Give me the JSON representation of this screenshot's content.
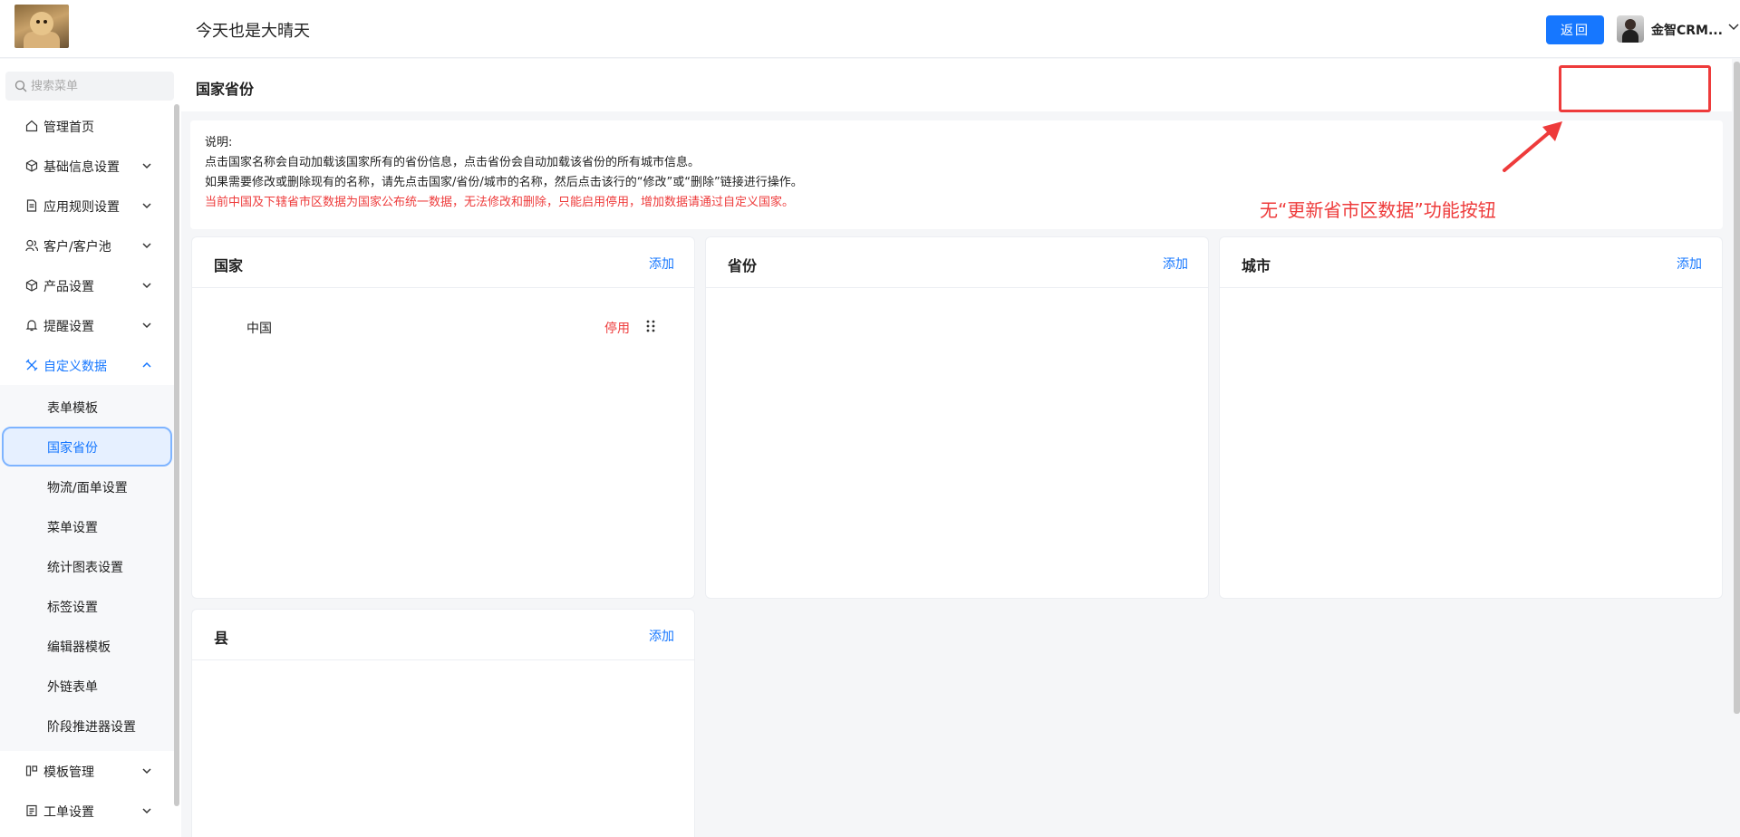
{
  "header": {
    "title": "今天也是大晴天",
    "back_label": "返回",
    "user_name": "金智CRM..."
  },
  "sidebar": {
    "search_placeholder": "搜索菜单",
    "items": [
      {
        "label": "管理首页",
        "icon": "home-icon"
      },
      {
        "label": "基础信息设置",
        "icon": "cube-icon"
      },
      {
        "label": "应用规则设置",
        "icon": "document-icon"
      },
      {
        "label": "客户/客户池",
        "icon": "users-icon"
      },
      {
        "label": "产品设置",
        "icon": "box-icon"
      },
      {
        "label": "提醒设置",
        "icon": "bell-icon"
      },
      {
        "label": "自定义数据",
        "icon": "tools-icon"
      }
    ],
    "subitems": [
      "表单模板",
      "国家省份",
      "物流/面单设置",
      "菜单设置",
      "统计图表设置",
      "标签设置",
      "编辑器模板",
      "外链表单",
      "阶段推进器设置"
    ],
    "bottom_items": [
      {
        "label": "模板管理",
        "icon": "template-icon"
      },
      {
        "label": "工单设置",
        "icon": "ticket-icon"
      }
    ]
  },
  "main": {
    "page_title": "国家省份",
    "notice": {
      "line1": "说明:",
      "line2": "点击国家名称会自动加载该国家所有的省份信息，点击省份会自动加载该省份的所有城市信息。",
      "line3": "如果需要修改或删除现有的名称，请先点击国家/省份/城市的名称，然后点击该行的“修改”或“删除”链接进行操作。",
      "line4": "当前中国及下辖省市区数据为国家公布统一数据，无法修改和删除，只能启用停用，增加数据请通过自定义国家。"
    },
    "panels": {
      "country": {
        "title": "国家",
        "add": "添加",
        "rows": [
          {
            "name": "中国",
            "action": "停用"
          }
        ]
      },
      "province": {
        "title": "省份",
        "add": "添加"
      },
      "city": {
        "title": "城市",
        "add": "添加"
      },
      "county": {
        "title": "县",
        "add": "添加"
      }
    }
  },
  "annotation": {
    "text": "无“更新省市区数据”功能按钮",
    "color": "#ee3b3b"
  },
  "colors": {
    "accent": "#1677ff",
    "danger": "#ee3b3b"
  }
}
